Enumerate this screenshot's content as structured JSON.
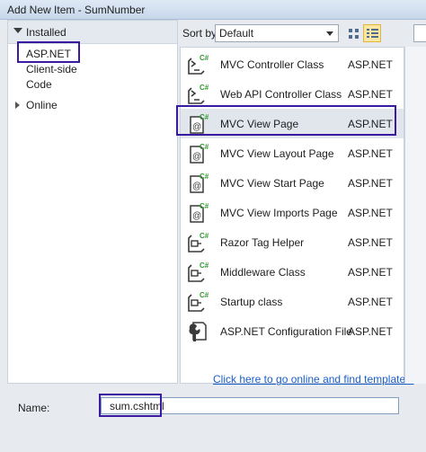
{
  "window": {
    "title": "Add New Item - SumNumber"
  },
  "left_pane": {
    "installed_label": "Installed",
    "items": [
      {
        "label": "ASP.NET"
      },
      {
        "label": "Client-side"
      },
      {
        "label": "Code"
      }
    ],
    "online_label": "Online"
  },
  "toolbar": {
    "sort_label": "Sort by:",
    "sort_value": "Default",
    "active_view": "list"
  },
  "templates": [
    {
      "name": "MVC Controller Class",
      "lang": "ASP.NET",
      "icon": "csharp-controller-icon"
    },
    {
      "name": "Web API Controller Class",
      "lang": "ASP.NET",
      "icon": "csharp-controller-icon"
    },
    {
      "name": "MVC View Page",
      "lang": "ASP.NET",
      "icon": "csharp-razor-page-icon",
      "selected": true
    },
    {
      "name": "MVC View Layout Page",
      "lang": "ASP.NET",
      "icon": "csharp-razor-page-icon"
    },
    {
      "name": "MVC View Start Page",
      "lang": "ASP.NET",
      "icon": "csharp-razor-page-icon"
    },
    {
      "name": "MVC View Imports Page",
      "lang": "ASP.NET",
      "icon": "csharp-razor-page-icon"
    },
    {
      "name": "Razor Tag Helper",
      "lang": "ASP.NET",
      "icon": "csharp-class-icon"
    },
    {
      "name": "Middleware Class",
      "lang": "ASP.NET",
      "icon": "csharp-class-icon"
    },
    {
      "name": "Startup class",
      "lang": "ASP.NET",
      "icon": "csharp-class-icon"
    },
    {
      "name": "ASP.NET Configuration File",
      "lang": "ASP.NET",
      "icon": "config-wrench-icon"
    }
  ],
  "online_link": "Click here to go online and find templates.",
  "name_field": {
    "label": "Name:",
    "value": "sum.cshtml"
  },
  "colors": {
    "accent_border": "#3a1aa0",
    "link": "#1a5ec8",
    "csharp_green": "#2f9a2f"
  }
}
